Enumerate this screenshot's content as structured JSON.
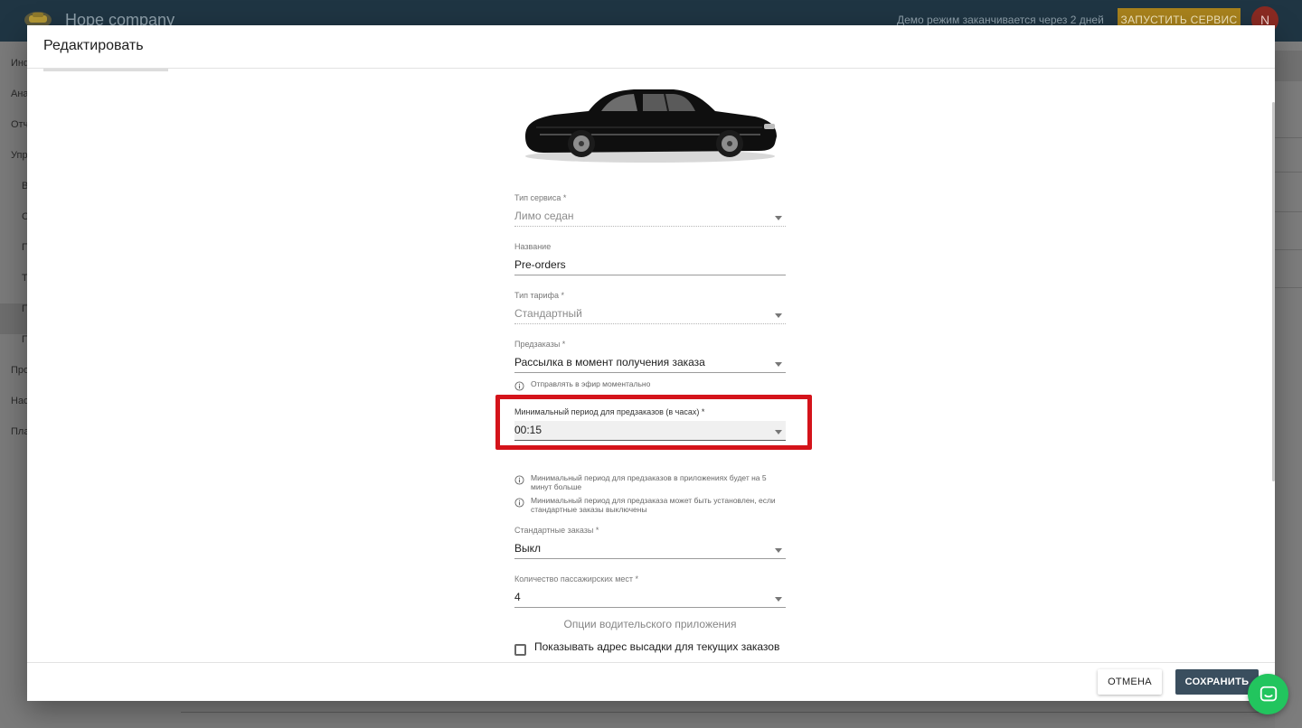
{
  "app": {
    "company": "Hope company",
    "demo_notice": "Демо режим заканчивается через 2 дней",
    "launch_button": "ЗАПУСТИТЬ СЕРВИС",
    "avatar_letter": "N"
  },
  "sidebar": {
    "items": [
      "Инф",
      "Ана",
      "Отч",
      "Упр",
      "В",
      "С",
      "П",
      "Т",
      "П",
      "П",
      "Про",
      "Нас",
      "Пла"
    ]
  },
  "modal": {
    "title": "Редактировать",
    "fields": {
      "service_type": {
        "label": "Тип сервиса *",
        "value": "Лимо седан"
      },
      "name": {
        "label": "Название",
        "value": "Pre-orders"
      },
      "tariff_type": {
        "label": "Тип тарифа *",
        "value": "Стандартный"
      },
      "preorders": {
        "label": "Предзаказы *",
        "value": "Рассылка в момент получения заказа",
        "hint": "Отправлять в эфир моментально"
      },
      "min_period": {
        "label": "Минимальный период для предзаказов (в часах) *",
        "value": "00:15",
        "hint1": "Минимальный период для предзаказов в приложениях будет на 5 минут больше",
        "hint2": "Минимальный период для предзаказа может быть установлен, если стандартные заказы выключены"
      },
      "standard_orders": {
        "label": "Стандартные заказы *",
        "value": "Выкл"
      },
      "seats": {
        "label": "Количество пассажирских мест *",
        "value": "4"
      }
    },
    "driver_app_section": {
      "title": "Опции водительского приложения",
      "show_dropoff_label": "Показывать адрес высадки для текущих заказов",
      "show_dropoff_checked": false
    },
    "cancel_button": "ОТМЕНА",
    "save_button": "СОХРАНИТЬ"
  },
  "colors": {
    "header_bg": "#1f3543",
    "launch_btn": "#a8821c",
    "highlight_box": "#d4131a",
    "save_btn": "#3a4e5e",
    "chat_btn": "#22c55e"
  },
  "icons": {
    "logo": "taxi-logo-icon",
    "info": "info-icon",
    "chevron": "caret-down-icon",
    "chat": "chat-bubble-icon"
  }
}
